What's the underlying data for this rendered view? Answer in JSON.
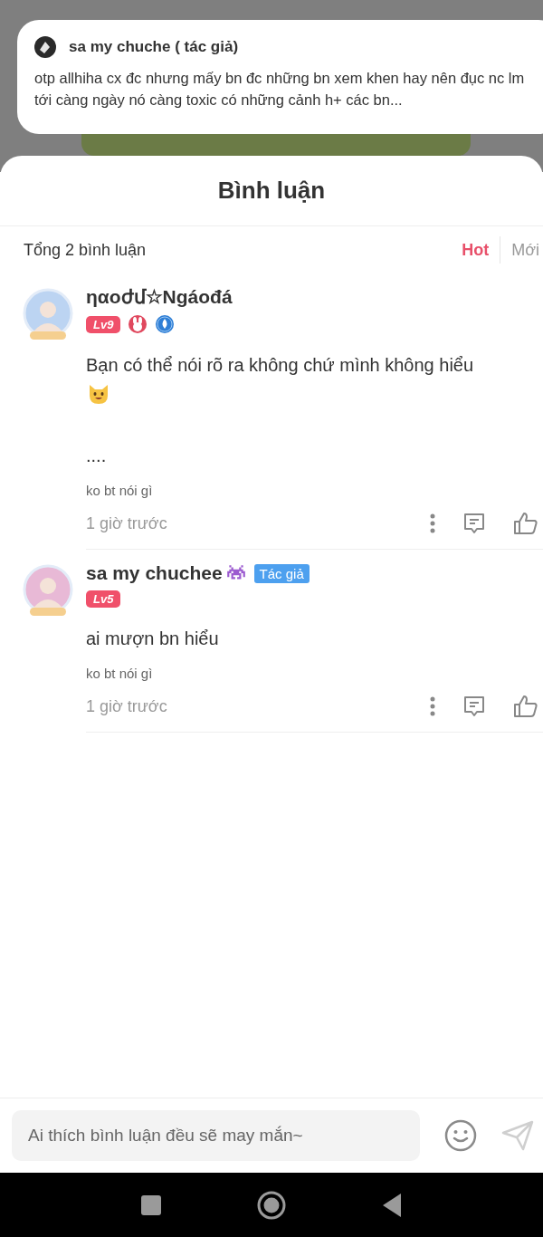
{
  "notification": {
    "author": "sa my chuche ( tác giả)",
    "message": "otp allhiha cx đc nhưng mấy bn đc những bn xem khen hay nên đục nc lm tới càng ngày nó càng toxic có những cảnh h+ các bn..."
  },
  "sheet": {
    "title": "Bình luận",
    "count": "Tổng 2 bình luận",
    "sort": [
      {
        "label": "Hot",
        "selected": true
      },
      {
        "label": "Mới",
        "selected": false
      }
    ]
  },
  "comments": [
    {
      "name": "ηαoժմ☆Ngáođá",
      "badges": [
        {
          "kind": "level",
          "text": "Lv9"
        },
        {
          "kind": "rabbit"
        },
        {
          "kind": "drop"
        }
      ],
      "blocks": [
        {
          "kind": "text",
          "text": "Bạn có thể nói rõ ra không chứ mình không hiểu"
        },
        {
          "kind": "cat"
        },
        {
          "kind": "gap"
        },
        {
          "kind": "text",
          "text": "...."
        }
      ],
      "signature": "ko bt nói gì",
      "time": "1 giờ trước"
    },
    {
      "name": "sa my chuchee",
      "name_icons": [
        {
          "kind": "alien"
        }
      ],
      "author_tag": "Tác giả",
      "badges": [
        {
          "kind": "level",
          "text": "Lv5"
        }
      ],
      "blocks": [
        {
          "kind": "text",
          "text": "ai mượn bn hiểu"
        }
      ],
      "signature": "ko bt nói gì",
      "time": "1 giờ trước"
    }
  ],
  "composer": {
    "placeholder": "Ai thích bình luận đều sẽ may mắn~"
  }
}
